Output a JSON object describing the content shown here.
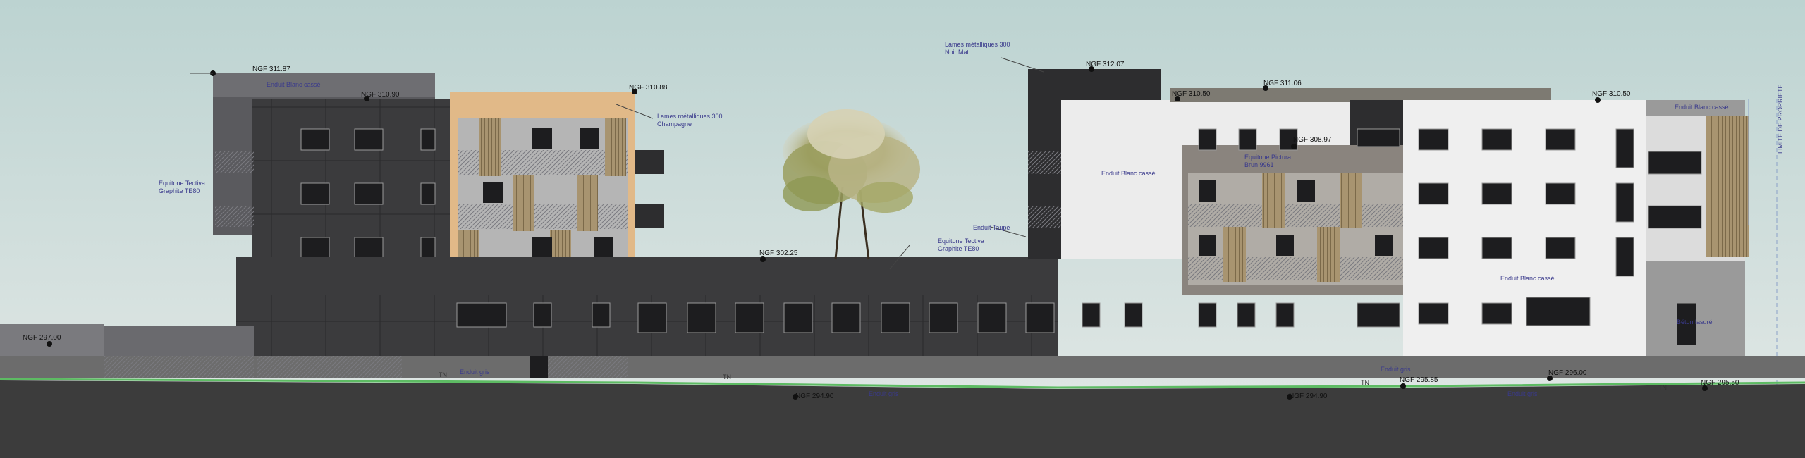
{
  "levels": {
    "l1": "NGF 311.87",
    "l2": "NGF 310.90",
    "l3": "NGF 310.88",
    "l4": "NGF 312.07",
    "l5": "NGF 310.50",
    "l6": "NGF 311.06",
    "l7": "NGF 310.50",
    "l8": "NGF 308.97",
    "l9": "NGF 302.25",
    "l10": "NGF 297.00",
    "l11": "NGF 294.90",
    "l12": "NGF 294.90",
    "l13": "NGF 295.85",
    "l14": "NGF 296.00",
    "l15": "NGF 295.50"
  },
  "materials": {
    "m1": "Enduit Blanc cassé",
    "m2a": "Lames métalliques 300",
    "m2b": "Champagne",
    "m3a": "Equitone Tectiva",
    "m3b": "Graphite TE80",
    "m4a": "Lames métalliques 300",
    "m4b": "Noir Mat",
    "m5": "Enduit Blanc cassé",
    "m6a": "Equitone Pictura",
    "m6b": "Brun 9961",
    "m7": "Enduit Taupe",
    "m8a": "Equitone Tectiva",
    "m8b": "Graphite TE80",
    "m9": "Enduit Blanc cassé",
    "m10": "Enduit Blanc cassé",
    "m11": "Béton lasuré",
    "m12": "Enduit gris",
    "m13": "Enduit gris",
    "m14": "Enduit gris",
    "m15": "Enduit gris"
  },
  "tn_labels": {
    "t1": "TN",
    "t2": "TN",
    "t3": "TN",
    "t4": "TN"
  },
  "property_limit": "LIMITE DE PROPRIETE",
  "colors": {
    "sky_top": "#bcd3d1",
    "sky_bottom": "#e2e8e6",
    "dark_facade": "#3b3b3d",
    "darker_facade": "#2d2d2f",
    "white_facade": "#ececec",
    "wood_cladding": "#e1b988",
    "taupe": "#8a847e",
    "ground": "#3c3c3c",
    "grass_line": "#5dbb63",
    "annotation": "#3a3a8c"
  }
}
